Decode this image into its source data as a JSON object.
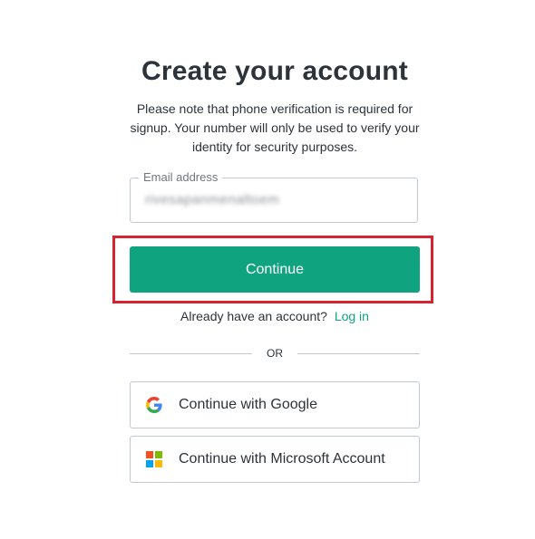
{
  "header": {
    "title": "Create your account",
    "subtitle": "Please note that phone verification is required for signup. Your number will only be used to verify your identity for security purposes."
  },
  "email": {
    "label": "Email address",
    "value": "rivesapanmenaltoem"
  },
  "continue": {
    "label": "Continue"
  },
  "login": {
    "prompt": "Already have an account?",
    "link": "Log in"
  },
  "divider": {
    "text": "OR"
  },
  "social": {
    "google_label": "Continue with Google",
    "microsoft_label": "Continue with Microsoft Account"
  },
  "colors": {
    "accent": "#10a37f",
    "highlight": "#d7232f",
    "text": "#2d333a",
    "border": "#c2c8d0"
  },
  "icons": {
    "google": "google-icon",
    "microsoft": "microsoft-icon"
  }
}
